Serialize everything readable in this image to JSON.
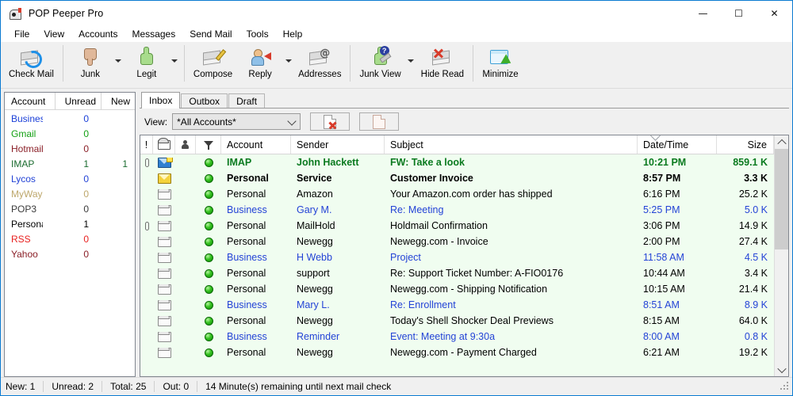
{
  "window": {
    "title": "POP Peeper Pro",
    "icon": "mailbox-icon",
    "controls": {
      "minimize": "—",
      "maximize": "☐",
      "close": "✕"
    }
  },
  "menu": {
    "items": [
      "File",
      "View",
      "Accounts",
      "Messages",
      "Send Mail",
      "Tools",
      "Help"
    ]
  },
  "toolbar": {
    "items": [
      {
        "label": "Check Mail",
        "icon": "check-mail-icon",
        "dropdown": false,
        "sep_after": true
      },
      {
        "label": "Junk",
        "icon": "thumbs-down-icon",
        "dropdown": true,
        "sep_after": false
      },
      {
        "label": "Legit",
        "icon": "thumbs-up-icon",
        "dropdown": true,
        "sep_after": true
      },
      {
        "label": "Compose",
        "icon": "compose-icon",
        "dropdown": false,
        "sep_after": false
      },
      {
        "label": "Reply",
        "icon": "reply-icon",
        "dropdown": true,
        "sep_after": false
      },
      {
        "label": "Addresses",
        "icon": "addresses-icon",
        "dropdown": false,
        "sep_after": true
      },
      {
        "label": "Junk View",
        "icon": "junk-view-icon",
        "dropdown": true,
        "sep_after": false
      },
      {
        "label": "Hide Read",
        "icon": "hide-read-icon",
        "dropdown": false,
        "sep_after": true
      },
      {
        "label": "Minimize",
        "icon": "minimize-icon",
        "dropdown": false,
        "sep_after": false
      }
    ]
  },
  "accounts_panel": {
    "headers": {
      "name": "Account",
      "unread": "Unread",
      "new": "New"
    },
    "rows": [
      {
        "name": "Business",
        "unread": "0",
        "new": "",
        "color": "#1a3fd8"
      },
      {
        "name": "Gmail",
        "unread": "0",
        "new": "",
        "color": "#13a013"
      },
      {
        "name": "Hotmail",
        "unread": "0",
        "new": "",
        "color": "#8a1f27"
      },
      {
        "name": "IMAP",
        "unread": "1",
        "new": "1",
        "color": "#1a6b2e"
      },
      {
        "name": "Lycos",
        "unread": "0",
        "new": "",
        "color": "#2343d6"
      },
      {
        "name": "MyWay",
        "unread": "0",
        "new": "",
        "color": "#bda76b"
      },
      {
        "name": "POP3",
        "unread": "0",
        "new": "",
        "color": "#3a3a3a"
      },
      {
        "name": "Personal",
        "unread": "1",
        "new": "",
        "color": "#000000"
      },
      {
        "name": "RSS",
        "unread": "0",
        "new": "",
        "color": "#e8201f"
      },
      {
        "name": "Yahoo",
        "unread": "0",
        "new": "",
        "color": "#8a1f27"
      }
    ]
  },
  "tabs": [
    {
      "label": "Inbox",
      "active": true
    },
    {
      "label": "Outbox",
      "active": false
    },
    {
      "label": "Draft",
      "active": false
    }
  ],
  "view_bar": {
    "label": "View:",
    "selected": "*All Accounts*",
    "options": [
      "*All Accounts*"
    ],
    "buttons": [
      {
        "name": "delete-view-button",
        "icon": "page-delete-icon"
      },
      {
        "name": "new-view-button",
        "icon": "page-blank-icon"
      }
    ]
  },
  "message_list": {
    "headers": {
      "flag": "!",
      "envelope": "envelope-icon",
      "user": "user-icon",
      "filter": "filter-icon",
      "account": "Account",
      "sender": "Sender",
      "subject": "Subject",
      "date": "Date/Time",
      "size": "Size"
    },
    "sort_column": "Date/Time",
    "sort_direction": "descending",
    "rows": [
      {
        "attachment": true,
        "status": "new",
        "dot": "green",
        "account": "IMAP",
        "sender": "John Hackett",
        "subject": "FW: Take a look",
        "date": "10:21 PM",
        "size": "859.1 K",
        "color": "#0a7a1f",
        "bold": true
      },
      {
        "attachment": false,
        "status": "unread",
        "dot": "green",
        "account": "Personal",
        "sender": "Service",
        "subject": "Customer Invoice",
        "date": "8:57 PM",
        "size": "3.3 K",
        "color": "#000000",
        "bold": true
      },
      {
        "attachment": false,
        "status": "read",
        "dot": "green",
        "account": "Personal",
        "sender": "Amazon",
        "subject": "Your Amazon.com order has shipped",
        "date": "6:16 PM",
        "size": "25.2 K",
        "color": "#000000",
        "bold": false
      },
      {
        "attachment": false,
        "status": "read",
        "dot": "green",
        "account": "Business",
        "sender": "Gary M.",
        "subject": "Re: Meeting",
        "date": "5:25 PM",
        "size": "5.0 K",
        "color": "#2343d6",
        "bold": false
      },
      {
        "attachment": true,
        "status": "read",
        "dot": "green",
        "account": "Personal",
        "sender": "MailHold",
        "subject": "Holdmail Confirmation",
        "date": "3:06 PM",
        "size": "14.9 K",
        "color": "#000000",
        "bold": false
      },
      {
        "attachment": false,
        "status": "read",
        "dot": "green",
        "account": "Personal",
        "sender": "Newegg",
        "subject": "Newegg.com - Invoice",
        "date": "2:00 PM",
        "size": "27.4 K",
        "color": "#000000",
        "bold": false
      },
      {
        "attachment": false,
        "status": "read",
        "dot": "green",
        "account": "Business",
        "sender": "H Webb",
        "subject": "Project",
        "date": "11:58 AM",
        "size": "4.5 K",
        "color": "#2343d6",
        "bold": false
      },
      {
        "attachment": false,
        "status": "read",
        "dot": "green",
        "account": "Personal",
        "sender": "support",
        "subject": "Re: Support Ticket Number: A-FIO0176",
        "date": "10:44 AM",
        "size": "3.4 K",
        "color": "#000000",
        "bold": false
      },
      {
        "attachment": false,
        "status": "read",
        "dot": "green",
        "account": "Personal",
        "sender": "Newegg",
        "subject": "Newegg.com - Shipping Notification",
        "date": "10:15 AM",
        "size": "21.4 K",
        "color": "#000000",
        "bold": false
      },
      {
        "attachment": false,
        "status": "read",
        "dot": "green",
        "account": "Business",
        "sender": "Mary L.",
        "subject": "Re: Enrollment",
        "date": "8:51 AM",
        "size": "8.9 K",
        "color": "#2343d6",
        "bold": false
      },
      {
        "attachment": false,
        "status": "read",
        "dot": "green",
        "account": "Personal",
        "sender": "Newegg",
        "subject": "Today's Shell Shocker Deal Previews",
        "date": "8:15 AM",
        "size": "64.0 K",
        "color": "#000000",
        "bold": false
      },
      {
        "attachment": false,
        "status": "read",
        "dot": "green",
        "account": "Business",
        "sender": "Reminder",
        "subject": "Event: Meeting at 9:30a",
        "date": "8:00 AM",
        "size": "0.8 K",
        "color": "#2343d6",
        "bold": false
      },
      {
        "attachment": false,
        "status": "read",
        "dot": "green",
        "account": "Personal",
        "sender": "Newegg",
        "subject": "Newegg.com - Payment  Charged",
        "date": "6:21 AM",
        "size": "19.2 K",
        "color": "#000000",
        "bold": false
      }
    ]
  },
  "status_bar": {
    "cells": [
      "New: 1",
      "Unread: 2",
      "Total: 25",
      "Out: 0",
      "14 Minute(s) remaining until next mail check"
    ]
  },
  "colors": {
    "window_border": "#0a7ad1",
    "list_background": "#f0fdf0",
    "chrome": "#f0f0f0",
    "link_blue": "#2343d6",
    "new_green": "#0a7a1f"
  }
}
